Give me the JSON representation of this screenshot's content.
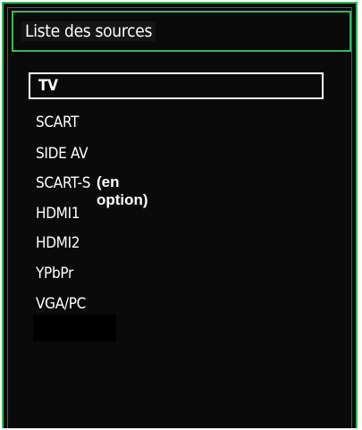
{
  "menu": {
    "title": "Liste des sources",
    "selected_index": 0,
    "items": [
      {
        "label": "TV"
      },
      {
        "label": "SCART"
      },
      {
        "label": "SIDE AV"
      },
      {
        "label": "SCART-S",
        "note": "(en option)"
      },
      {
        "label": "HDMI1"
      },
      {
        "label": "HDMI2"
      },
      {
        "label": "YPbPr"
      },
      {
        "label": "VGA/PC"
      }
    ]
  },
  "colors": {
    "panel_background": "#0a0a0a",
    "border_accent": "#33b85a",
    "text": "#ffffff",
    "selection_border": "#ffffff"
  }
}
